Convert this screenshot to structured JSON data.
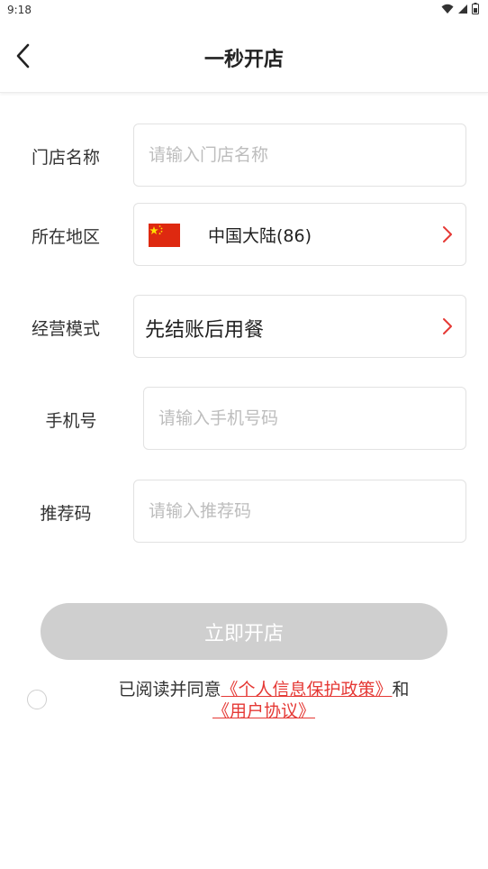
{
  "status": {
    "time": "9:18"
  },
  "header": {
    "title": "一秒开店"
  },
  "form": {
    "store_name": {
      "label": "门店名称",
      "placeholder": "请输入门店名称",
      "value": ""
    },
    "region": {
      "label": "所在地区",
      "value": "中国大陆(86)"
    },
    "mode": {
      "label": "经营模式",
      "value": "先结账后用餐"
    },
    "phone": {
      "label": "手机号",
      "placeholder": "请输入手机号码",
      "value": ""
    },
    "referral": {
      "label": "推荐码",
      "placeholder": "请输入推荐码",
      "value": ""
    }
  },
  "submit_label": "立即开店",
  "agreement": {
    "prefix": "已阅读并同意",
    "privacy_link": "《个人信息保护政策》",
    "and": "和",
    "terms_link": "《用户协议》"
  },
  "colors": {
    "accent": "#e53935",
    "button_disabled": "#cfcfcf",
    "flag_red": "#de2910",
    "flag_yellow": "#ffde00"
  }
}
